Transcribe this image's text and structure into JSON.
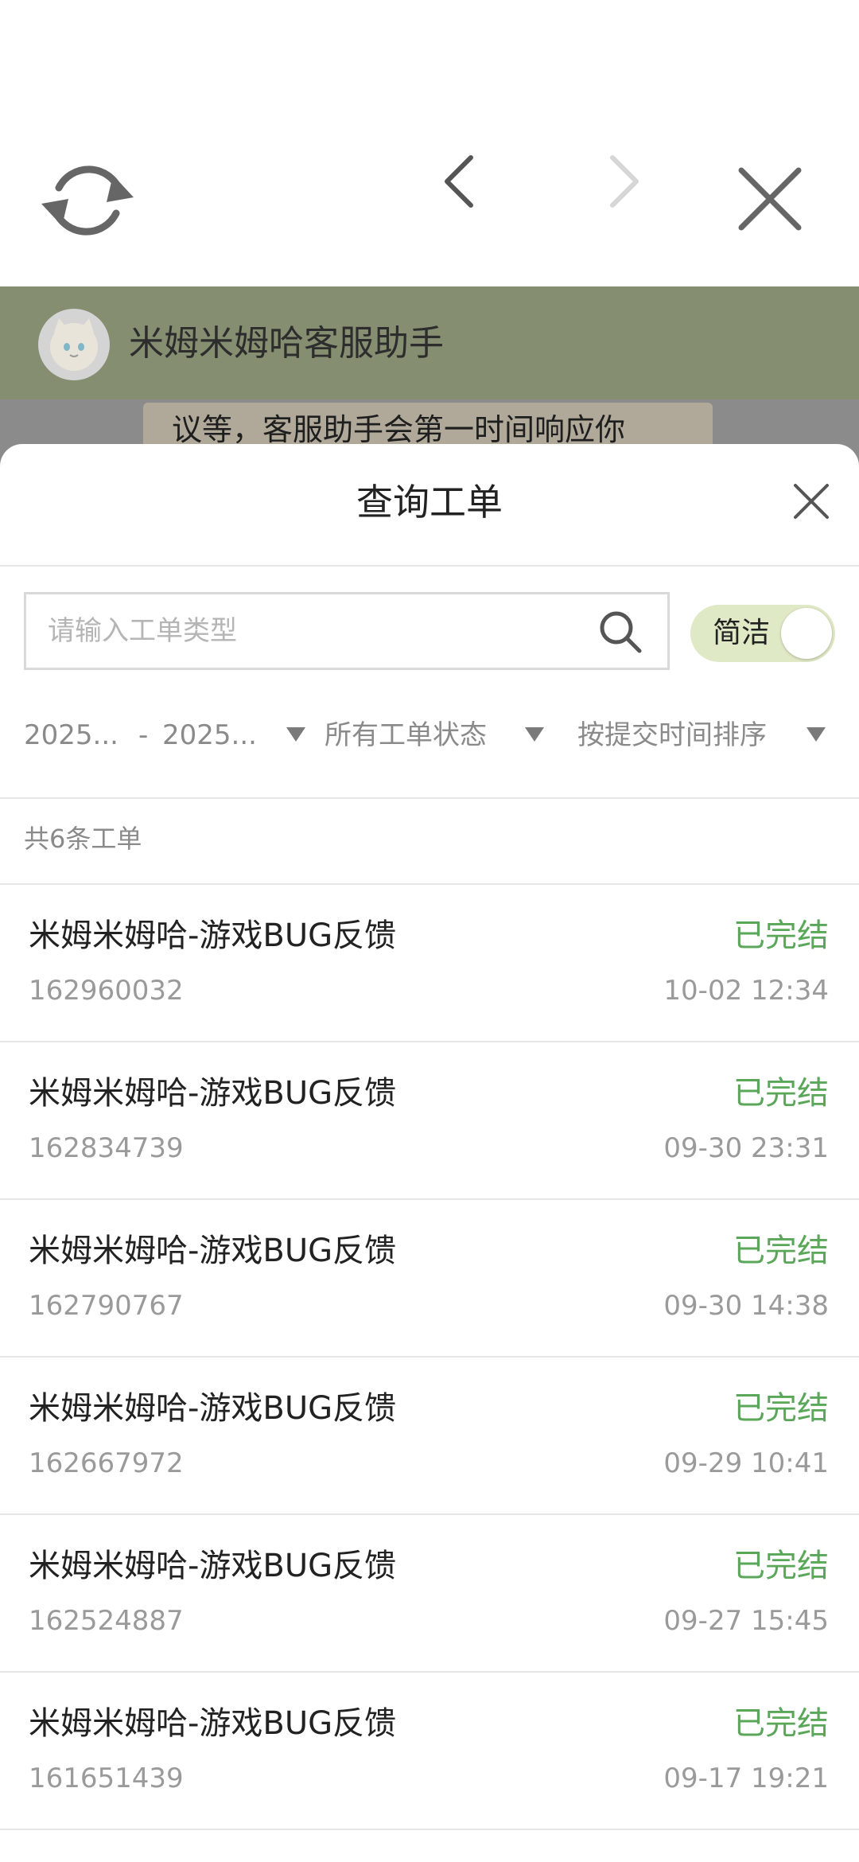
{
  "browser": {
    "refresh_icon": "refresh-icon",
    "back_icon": "chevron-left-icon",
    "forward_icon": "chevron-right-icon",
    "close_icon": "close-icon"
  },
  "chat": {
    "title": "米姆米姆哈客服助手",
    "bubble_text": "议等，客服助手会第一时间响应你"
  },
  "sheet": {
    "title": "查询工单",
    "close_icon": "close-icon",
    "search": {
      "placeholder": "请输入工单类型",
      "value": "",
      "icon": "search-icon"
    },
    "toggle": {
      "label": "简洁",
      "on": true
    },
    "filters": {
      "date_start": "2025...",
      "date_separator": "-",
      "date_end": "2025...",
      "status": "所有工单状态",
      "sort": "按提交时间排序"
    },
    "count_text": "共6条工单",
    "tickets": [
      {
        "title": "米姆米姆哈-游戏BUG反馈",
        "status": "已完结",
        "id": "162960032",
        "time": "10-02 12:34"
      },
      {
        "title": "米姆米姆哈-游戏BUG反馈",
        "status": "已完结",
        "id": "162834739",
        "time": "09-30 23:31"
      },
      {
        "title": "米姆米姆哈-游戏BUG反馈",
        "status": "已完结",
        "id": "162790767",
        "time": "09-30 14:38"
      },
      {
        "title": "米姆米姆哈-游戏BUG反馈",
        "status": "已完结",
        "id": "162667972",
        "time": "09-29 10:41"
      },
      {
        "title": "米姆米姆哈-游戏BUG反馈",
        "status": "已完结",
        "id": "162524887",
        "time": "09-27 15:45"
      },
      {
        "title": "米姆米姆哈-游戏BUG反馈",
        "status": "已完结",
        "id": "161651439",
        "time": "09-17 19:21"
      }
    ]
  },
  "colors": {
    "status_done": "#5aa75a",
    "toggle_bg": "#dfe9c5",
    "chat_header_bg": "#858e70"
  }
}
